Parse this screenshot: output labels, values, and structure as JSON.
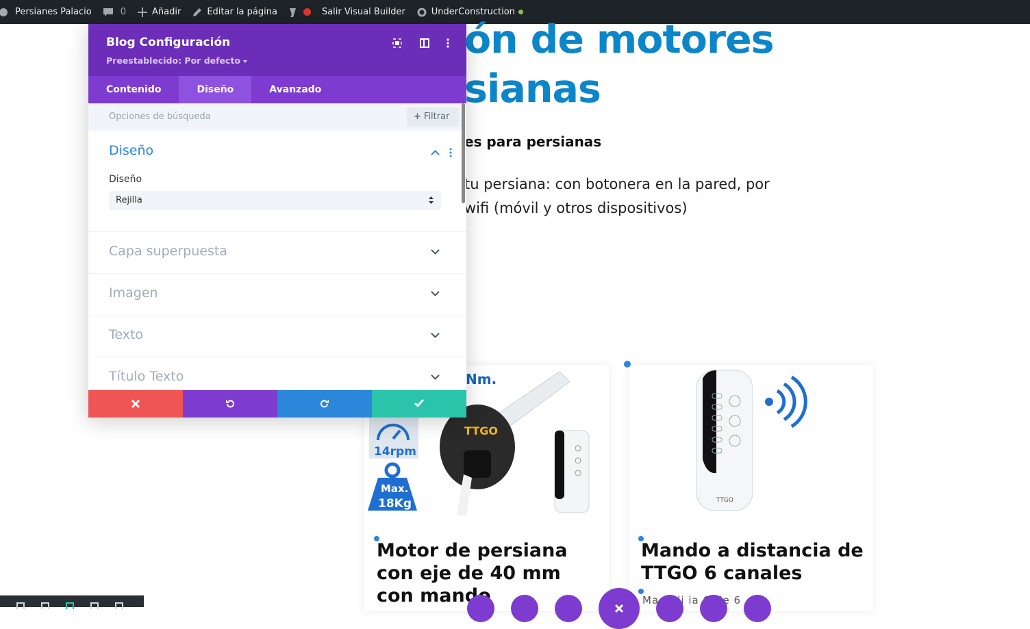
{
  "adminbar": {
    "site_name": "Persianes Palacio",
    "comments_count": "0",
    "add_new": "Añadir",
    "edit_page": "Editar la página",
    "exit_builder": "Salir Visual Builder",
    "under_construction": "UnderConstruction"
  },
  "page": {
    "hero_line1": "ón de motores",
    "hero_line2": "sianas",
    "subheading": "es para persianas",
    "para_line1": "tu persiana: con botonera en la pared, por",
    "para_line2": "wifi (móvil y otros dispositivos)",
    "card1": {
      "title": "Motor de persiana con eje de 40 mm con mando",
      "badge_nm": "Nm.",
      "badge_rpm": "14rpm",
      "badge_max": "Max.",
      "badge_kg": "18Kg",
      "brand": "TTGO"
    },
    "card2": {
      "title": "Mando a distancia de TTGO 6 canales",
      "excerpt": "Ma   a di   ia   O de 6",
      "brand": "TTGO"
    }
  },
  "modal": {
    "title": "Blog Configuración",
    "preset": "Preestablecido: Por defecto",
    "tabs": [
      "Contenido",
      "Diseño",
      "Avanzado"
    ],
    "active_tab": "Diseño",
    "search_placeholder": "Opciones de búsqueda",
    "filter_label": "Filtrar",
    "open_section": {
      "title": "Diseño",
      "field_label": "Diseño",
      "select_value": "Rejilla"
    },
    "sections": [
      "Capa superpuesta",
      "Imagen",
      "Texto",
      "Título Texto"
    ]
  },
  "colors": {
    "purple_dark": "#6c2eb9",
    "purple": "#7e3bd0",
    "cancel_red": "#ef5555",
    "undo_purple": "#7e3bd0",
    "redo_blue": "#2b87da",
    "save_green": "#29c4a9",
    "hero_blue": "#0c86c9"
  }
}
